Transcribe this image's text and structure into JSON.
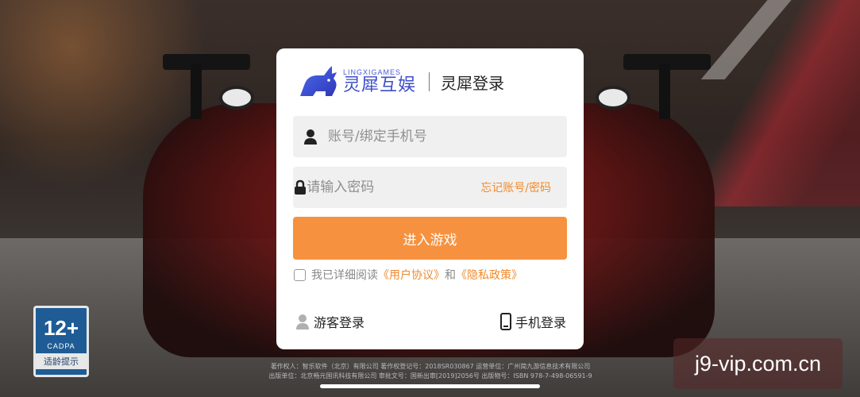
{
  "brand": {
    "logo_small": "LINGXIGAMES",
    "logo_big": "灵犀互娱",
    "title": "灵犀登录"
  },
  "login": {
    "account_placeholder": "账号/绑定手机号",
    "password_placeholder": "请输入密码",
    "forgot_label": "忘记账号/密码",
    "enter_label": "进入游戏",
    "agreement_prefix": "我已详细阅读",
    "agreement_user": "《用户协议》",
    "agreement_and": "和",
    "agreement_privacy": "《隐私政策》",
    "agreement_checked": false,
    "guest_label": "游客登录",
    "phone_label": "手机登录"
  },
  "age_rating": {
    "number": "12+",
    "org": "CADPA",
    "tip": "适龄提示"
  },
  "copyright": {
    "line1": "著作权人：智乐软件（北京）有限公司    著作权登记号：2018SR030867    运营单位：广州简九游信息技术有限公司",
    "line2": "出版单位：北京畅元国讯科技有限公司    审批文号：国新出审[2019]2056号    出版物号：ISBN 978-7-498-06591-9"
  },
  "watermark": "j9-vip.com.cn",
  "colors": {
    "accent": "#f6923f",
    "link": "#f08a2c",
    "brand_blue": "#3d4ec9"
  }
}
